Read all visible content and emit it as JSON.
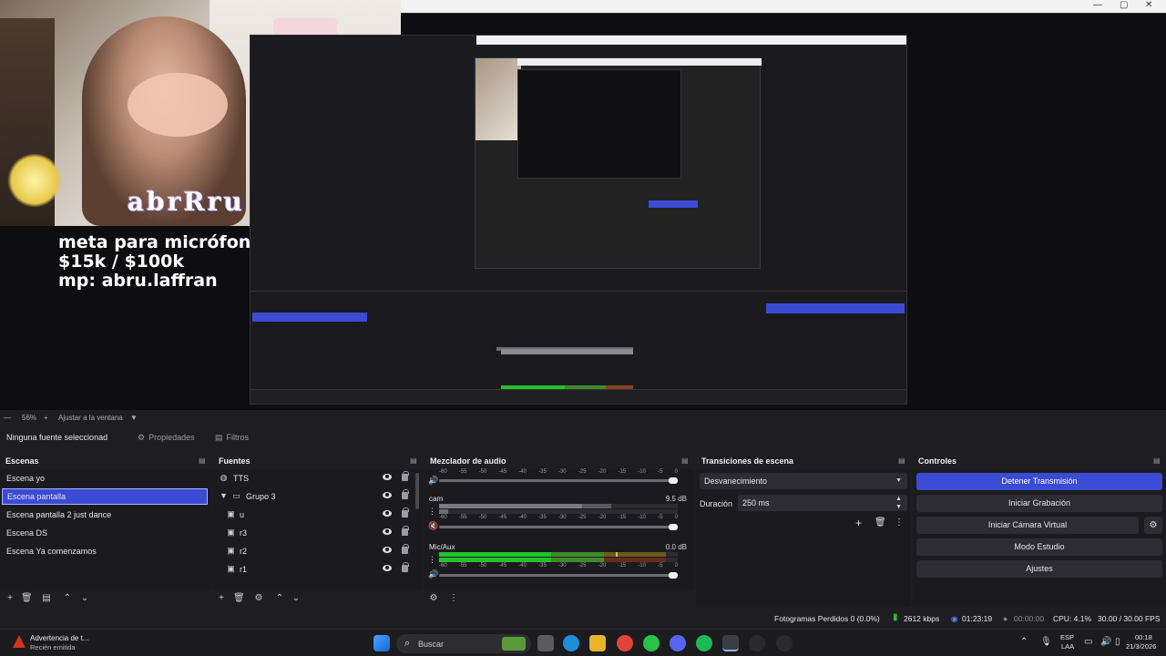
{
  "preview": {
    "overlay_text": [
      "meta para micrófono",
      "$15k / $100k",
      "mp: abru.laffran"
    ],
    "brand_text": "abrRru",
    "zoom": "56%",
    "fit_label": "Ajustar a la ventana"
  },
  "toolbar": {
    "no_source": "Ninguna fuente seleccionad",
    "properties": "Propiedades",
    "filters": "Filtros"
  },
  "scenes": {
    "title": "Escenas",
    "items": [
      "Escena yo",
      "Escena pantalla",
      "Escena pantalla 2 just dance",
      "Escena DS",
      "Escena Ya comenzamos"
    ],
    "selected_index": 1
  },
  "sources": {
    "title": "Fuentes",
    "items": [
      {
        "label": "TTS",
        "icon": "browser-icon",
        "indent": 0
      },
      {
        "label": "Grupo 3",
        "icon": "folder-icon",
        "indent": 1,
        "expanded": true
      },
      {
        "label": "u",
        "icon": "image-icon",
        "indent": 1
      },
      {
        "label": "r3",
        "icon": "image-icon",
        "indent": 1
      },
      {
        "label": "r2",
        "icon": "image-icon",
        "indent": 1
      },
      {
        "label": "r1",
        "icon": "image-icon",
        "indent": 1
      }
    ]
  },
  "mixer": {
    "title": "Mezclador de audio",
    "ticks": [
      "-60",
      "-55",
      "-50",
      "-45",
      "-40",
      "-35",
      "-30",
      "-25",
      "-20",
      "-15",
      "-10",
      "-5",
      "0"
    ],
    "channels": [
      {
        "name": "",
        "db": ""
      },
      {
        "name": "cam",
        "db": "9.5 dB"
      },
      {
        "name": "Mic/Aux",
        "db": "0.0 dB"
      }
    ]
  },
  "transitions": {
    "title": "Transiciones de escena",
    "selected": "Desvanecimiento",
    "duration_label": "Duración",
    "duration_value": "250 ms"
  },
  "controls": {
    "title": "Controles",
    "buttons": [
      "Detener Transmisión",
      "Iniciar Grabación",
      "Iniciar Cámara Virtual",
      "Modo Estudio",
      "Ajustes"
    ]
  },
  "status": {
    "dropped": "Fotogramas Perdidos 0 (0.0%)",
    "bitrate": "2612 kbps",
    "stream_time": "01:23:19",
    "rec_time": "00:00:00",
    "cpu": "CPU: 4.1%",
    "fps": "30.00 / 30.00 FPS"
  },
  "taskbar": {
    "notification_title": "Advertencia de t...",
    "notification_sub": "Recién emitida",
    "search_placeholder": "Buscar",
    "lang": "ESP",
    "lang_sub": "LAA",
    "time": "00:18",
    "date": "21/3/2026"
  },
  "colors": {
    "accent": "#3b4bd3",
    "meter_green": "#22c32a",
    "meter_yellow": "#b7a31d",
    "meter_red": "#b0262b"
  }
}
